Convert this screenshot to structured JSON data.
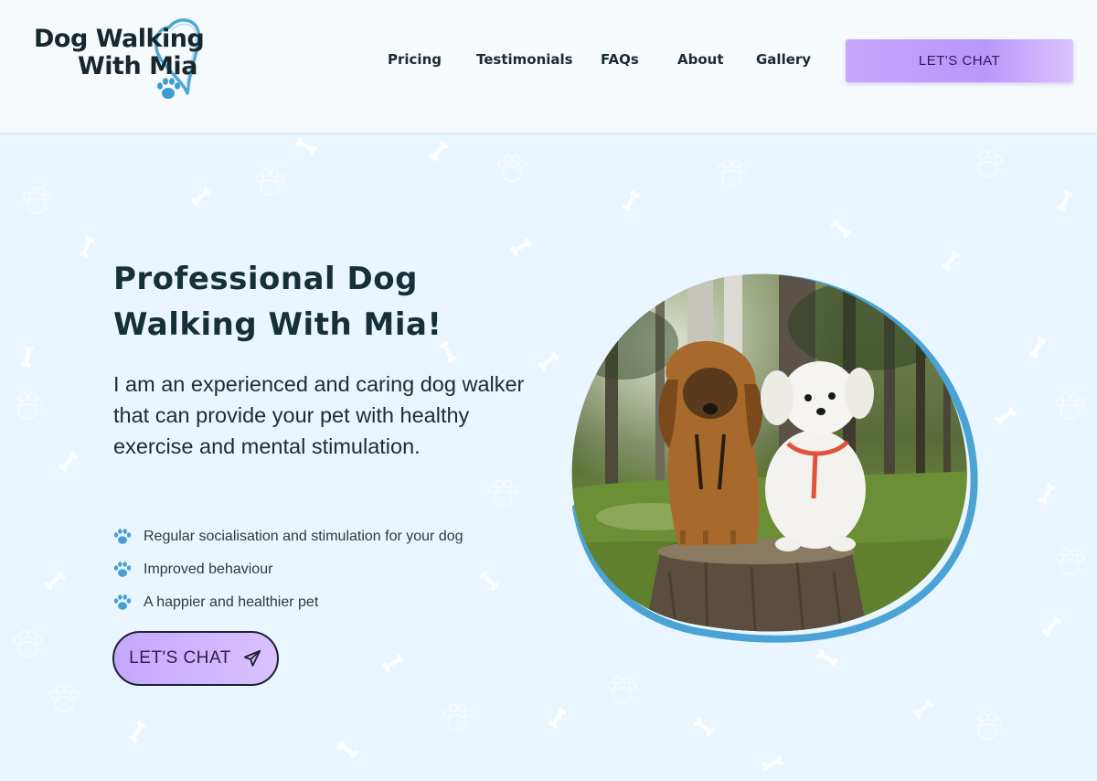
{
  "brand": {
    "line1": "Dog Walking",
    "line2": "With Mia",
    "accent_color": "#5aa9d6"
  },
  "nav": {
    "items": [
      {
        "label": "Pricing"
      },
      {
        "label": "Testimonials"
      },
      {
        "label": "FAQs"
      },
      {
        "label": "About"
      },
      {
        "label": "Gallery"
      }
    ],
    "cta_label": "LET'S CHAT"
  },
  "hero": {
    "title_line1": "Professional Dog",
    "title_line2": "Walking With Mia!",
    "description": "I am an experienced and caring dog walker that can provide your pet with healthy exercise and mental stimulation.",
    "benefits": [
      "Regular socialisation and stimulation for your dog",
      "Improved behaviour",
      "A happier and healthier pet"
    ],
    "cta_label": "LET'S CHAT",
    "cta_icon": "paper-plane-icon",
    "bullet_icon": "paw-icon"
  },
  "colors": {
    "background": "#eaf6ff",
    "header_bg": "#f6fafd",
    "cta_purple": "#c6a6ff",
    "heading": "#16303a",
    "paw_blue": "#4a9fd0",
    "photo_frame_blue": "#4aa3d4"
  }
}
